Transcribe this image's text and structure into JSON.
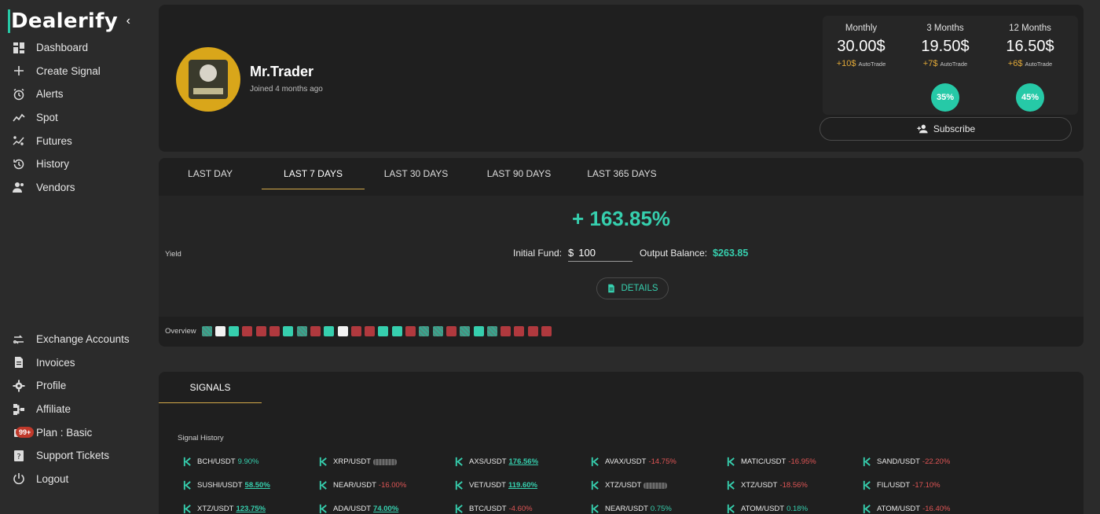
{
  "brand": {
    "name": "Dealerify",
    "collapse_icon": "chevron-left-icon"
  },
  "sidebar": {
    "top": [
      {
        "label": "Dashboard",
        "icon": "dashboard-icon"
      },
      {
        "label": "Create Signal",
        "icon": "plus-icon"
      },
      {
        "label": "Alerts",
        "icon": "alarm-icon"
      },
      {
        "label": "Spot",
        "icon": "trend-icon"
      },
      {
        "label": "Futures",
        "icon": "futures-icon"
      },
      {
        "label": "History",
        "icon": "history-icon"
      },
      {
        "label": "Vendors",
        "icon": "vendors-icon"
      }
    ],
    "bottom": [
      {
        "label": "Exchange Accounts",
        "icon": "exchange-icon"
      },
      {
        "label": "Invoices",
        "icon": "invoice-icon"
      },
      {
        "label": "Profile",
        "icon": "gear-icon"
      },
      {
        "label": "Affiliate",
        "icon": "affiliate-icon"
      },
      {
        "label": "Plan : Basic",
        "icon": "plan-icon",
        "badge": "99+"
      },
      {
        "label": "Support Tickets",
        "icon": "support-icon"
      },
      {
        "label": "Logout",
        "icon": "power-icon"
      }
    ]
  },
  "profile": {
    "name": "Mr.Trader",
    "joined": "Joined 4 months ago",
    "plans": [
      {
        "label": "Monthly",
        "price": "30.00$",
        "extra": "+10$",
        "extra_note": "AutoTrade"
      },
      {
        "label": "3 Months",
        "price": "19.50$",
        "extra": "+7$",
        "extra_note": "AutoTrade",
        "discount": "35%"
      },
      {
        "label": "12 Months",
        "price": "16.50$",
        "extra": "+6$",
        "extra_note": "AutoTrade",
        "discount": "45%"
      }
    ],
    "subscribe_label": "Subscribe"
  },
  "stats": {
    "tabs": [
      "LAST DAY",
      "LAST 7 DAYS",
      "LAST 30 DAYS",
      "LAST 90 DAYS",
      "LAST 365 DAYS"
    ],
    "active_tab": 1,
    "yield_value": "+ 163.85%",
    "yield_label": "Yield",
    "initial_fund_label": "Initial Fund:",
    "currency": "$",
    "initial_fund_value": "100",
    "output_label": "Output Balance:",
    "output_value": "$263.85",
    "details_label": "DETAILS",
    "overview_label": "Overview",
    "overview": [
      "h",
      "w",
      "g",
      "r",
      "r",
      "r",
      "g",
      "h",
      "r",
      "g",
      "w",
      "r",
      "r",
      "g",
      "g",
      "r",
      "h",
      "h",
      "r",
      "h",
      "g",
      "h",
      "r",
      "r",
      "r",
      "r"
    ],
    "colors": {
      "accent": "#36cfae",
      "loss": "#b0393e",
      "gold": "#d4a94a"
    }
  },
  "signals": {
    "tab_label": "SIGNALS",
    "history_label": "Signal History",
    "items": [
      {
        "pair": "BCH/USDT",
        "value": "9.90%",
        "type": "pos"
      },
      {
        "pair": "XRP/USDT",
        "value": "",
        "type": "blur"
      },
      {
        "pair": "AXS/USDT",
        "value": "176.56%",
        "type": "posu"
      },
      {
        "pair": "AVAX/USDT",
        "value": "-14.75%",
        "type": "neg"
      },
      {
        "pair": "MATIC/USDT",
        "value": "-16.95%",
        "type": "neg"
      },
      {
        "pair": "SAND/USDT",
        "value": "-22.20%",
        "type": "neg"
      },
      {
        "pair": "SUSHI/USDT",
        "value": "58.50%",
        "type": "posu"
      },
      {
        "pair": "NEAR/USDT",
        "value": "-16.00%",
        "type": "neg"
      },
      {
        "pair": "VET/USDT",
        "value": "119.60%",
        "type": "posu"
      },
      {
        "pair": "XTZ/USDT",
        "value": "",
        "type": "blur"
      },
      {
        "pair": "XTZ/USDT",
        "value": "-18.56%",
        "type": "neg"
      },
      {
        "pair": "FIL/USDT",
        "value": "-17.10%",
        "type": "neg"
      },
      {
        "pair": "XTZ/USDT",
        "value": "123.75%",
        "type": "posu"
      },
      {
        "pair": "ADA/USDT",
        "value": "74.00%",
        "type": "posu"
      },
      {
        "pair": "BTC/USDT",
        "value": "-4.60%",
        "type": "neg"
      },
      {
        "pair": "NEAR/USDT",
        "value": "0.75%",
        "type": "pos"
      },
      {
        "pair": "ATOM/USDT",
        "value": "0.18%",
        "type": "pos"
      },
      {
        "pair": "ATOM/USDT",
        "value": "-16.40%",
        "type": "neg"
      }
    ]
  }
}
